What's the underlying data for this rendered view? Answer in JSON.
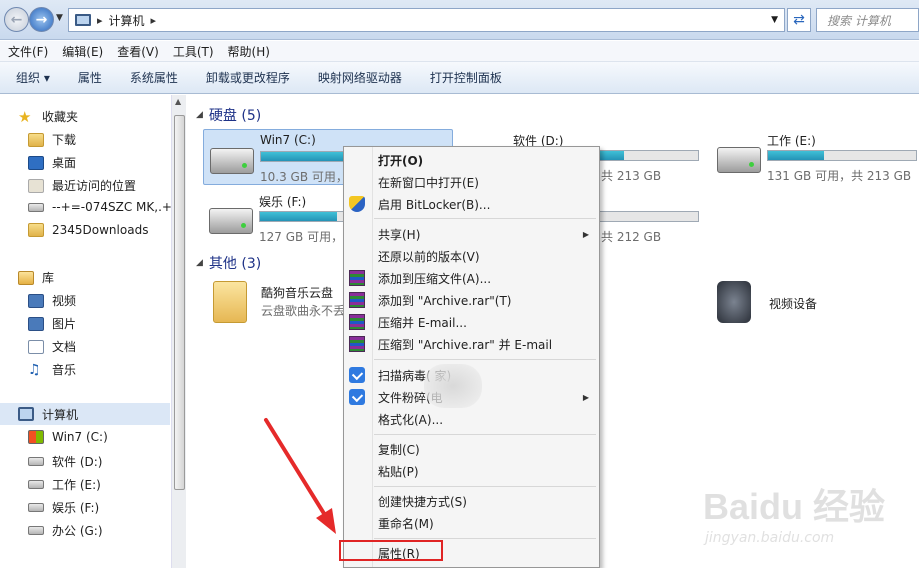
{
  "window": {
    "address": {
      "crumb": "计算机"
    },
    "search_placeholder": "搜索 计算机"
  },
  "menubar": [
    "文件(F)",
    "编辑(E)",
    "查看(V)",
    "工具(T)",
    "帮助(H)"
  ],
  "toolbar": [
    "组织 ▾",
    "属性",
    "系统属性",
    "卸载或更改程序",
    "映射网络驱动器",
    "打开控制面板"
  ],
  "sidebar": {
    "favorites": {
      "label": "收藏夹",
      "items": [
        "下载",
        "桌面",
        "最近访问的位置",
        "--+=-074SZC MK,.+",
        "2345Downloads"
      ]
    },
    "libraries": {
      "label": "库",
      "items": [
        "视频",
        "图片",
        "文档",
        "音乐"
      ]
    },
    "computer": {
      "label": "计算机",
      "items": [
        "Win7 (C:)",
        "软件 (D:)",
        "工作 (E:)",
        "娱乐 (F:)",
        "办公 (G:)"
      ]
    }
  },
  "main": {
    "disks_header": "硬盘 (5)",
    "others_header": "其他 (3)",
    "drives": [
      {
        "name": "Win7 (C:)",
        "free": "10.3 GB 可用，",
        "used_fraction": 0.88
      },
      {
        "name": "软件 (D:)",
        "free": "共 213 GB",
        "used_fraction": 0.6
      },
      {
        "name": "工作 (E:)",
        "free": "131 GB 可用，共 213 GB",
        "used_fraction": 0.38
      },
      {
        "name": "娱乐 (F:)",
        "free": "127 GB 可用，",
        "used_fraction": 0.42
      },
      {
        "name": "",
        "free": "共 212 GB",
        "used_fraction": 0.1
      }
    ],
    "others": [
      {
        "name": "酷狗音乐云盘",
        "sub": "云盘歌曲永不丢"
      },
      {
        "name": "视频设备",
        "sub": ""
      }
    ]
  },
  "context_menu": {
    "items": [
      {
        "label": "打开(O)",
        "bold": true
      },
      {
        "label": "在新窗口中打开(E)"
      },
      {
        "label": "启用 BitLocker(B)...",
        "icon": "shield"
      },
      {
        "label": "共享(H)",
        "submenu": true
      },
      {
        "label": "还原以前的版本(V)"
      },
      {
        "label": "添加到压缩文件(A)...",
        "icon": "rar"
      },
      {
        "label": "添加到 \"Archive.rar\"(T)",
        "icon": "rar"
      },
      {
        "label": "压缩并 E-mail...",
        "icon": "rar"
      },
      {
        "label": "压缩到 \"Archive.rar\" 并 E-mail",
        "icon": "rar"
      },
      {
        "label": "扫描病毒(        家)",
        "icon": "guard"
      },
      {
        "label": "文件粉碎(电",
        "icon": "guard",
        "submenu": true
      },
      {
        "label": "格式化(A)..."
      },
      {
        "label": "复制(C)"
      },
      {
        "label": "粘贴(P)"
      },
      {
        "label": "创建快捷方式(S)"
      },
      {
        "label": "重命名(M)"
      },
      {
        "label": "属性(R)"
      }
    ]
  },
  "watermark": {
    "main": "Baidu 经验",
    "sub": "jingyan.baidu.com"
  }
}
